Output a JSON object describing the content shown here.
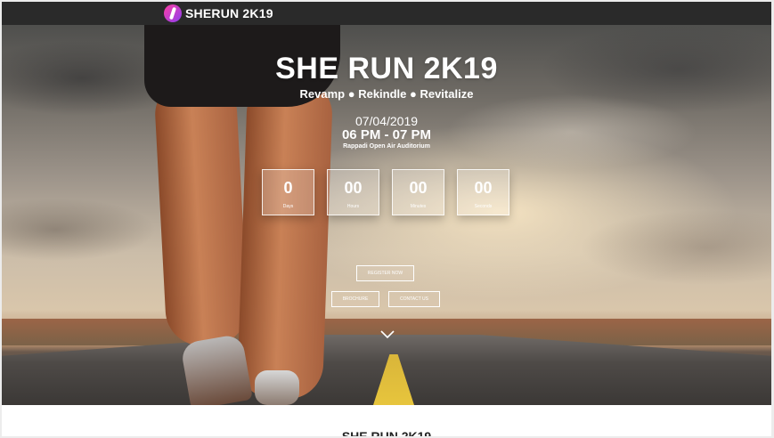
{
  "brand": {
    "logo_text": "SHERUN 2K19"
  },
  "hero": {
    "title": "SHE RUN 2K19",
    "tagline": "Revamp ● Rekindle ● Revitalize",
    "date": "07/04/2019",
    "time": "06 PM - 07 PM",
    "venue": "Rappadi Open Air Auditorium"
  },
  "countdown": [
    {
      "value": "0",
      "label": "Days"
    },
    {
      "value": "00",
      "label": "Hours"
    },
    {
      "value": "00",
      "label": "Minutes"
    },
    {
      "value": "00",
      "label": "Seconds"
    }
  ],
  "buttons": {
    "register": "REGISTER NOW",
    "brochure": "BROCHURE",
    "contact": "CONTACT US"
  },
  "icons": {
    "scroll": "chevron-down-icon",
    "logo": "runner-logo-icon"
  },
  "next_section": {
    "title": "SHE RUN 2K19"
  },
  "colors": {
    "topbar": "#2a2a2a",
    "accent_logo": "#d63fbf",
    "road_line": "#e1c03c"
  }
}
